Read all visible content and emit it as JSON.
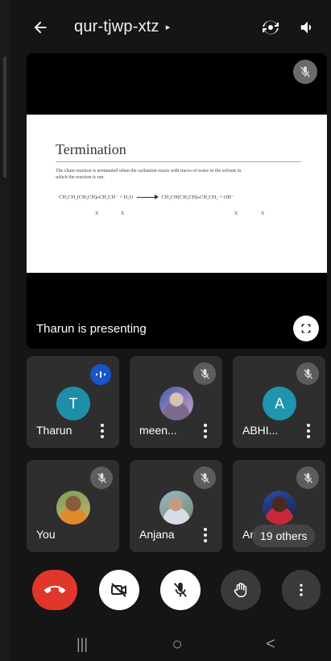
{
  "meeting": {
    "code": "qur-tjwp-xtz",
    "title_caret": "▸"
  },
  "presentation": {
    "slide_title": "Termination",
    "slide_text": "The chain reaction is terminated when the carbanion reacts with traces of water in the solvent in which the reaction is run.",
    "equation_left": "CH₂CH₂(CH₂CH)ₙCH₂CH⁻  +  H₂O",
    "equation_right": "CH₂CH(CH₂CH)ₙCH₂CH₂  +  OH⁻",
    "sub_x": "X",
    "presenting_label": "Tharun is presenting"
  },
  "participants": [
    {
      "name": "Tharun",
      "avatar_letter": "T",
      "avatar_color": "#1e8fa7",
      "status": "speaking"
    },
    {
      "name": "meen...",
      "avatar_letter": "",
      "status": "muted"
    },
    {
      "name": "ABHI...",
      "avatar_letter": "A",
      "avatar_color": "#1f95b0",
      "status": "muted"
    },
    {
      "name": "You",
      "avatar_letter": "",
      "status": "muted"
    },
    {
      "name": "Anjana",
      "avatar_letter": "",
      "status": "muted"
    },
    {
      "name": "An",
      "avatar_letter": "",
      "status": "muted"
    }
  ],
  "others_label": "19 others",
  "colors": {
    "end_call": "#e0362c",
    "speaking_badge": "#1a55c7",
    "tile_bg": "#2e2e2e"
  },
  "icons": {
    "back": "arrow-left-icon",
    "switch_camera": "switch-camera-icon",
    "speaker": "speaker-icon",
    "mic_off": "mic-off-icon",
    "fullscreen": "fullscreen-icon",
    "end_call": "end-call-icon",
    "camera_off": "camera-off-icon",
    "raise_hand": "raise-hand-icon",
    "more": "more-vert-icon"
  },
  "nav": {
    "recents": "|||",
    "home": "○",
    "back": "<"
  }
}
